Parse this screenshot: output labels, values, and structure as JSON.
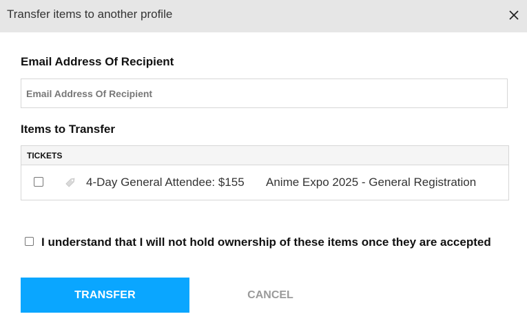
{
  "modal": {
    "title": "Transfer items to another profile",
    "close_icon": "close-icon"
  },
  "email": {
    "label": "Email Address Of Recipient",
    "value": "",
    "placeholder": "Email Address Of Recipient"
  },
  "items": {
    "label": "Items to Transfer",
    "section_header": "TICKETS",
    "tickets": [
      {
        "name": "4-Day General Attendee: $155",
        "event": "Anime Expo 2025 - General Registration",
        "checked": false,
        "icon": "ticket-tag-icon"
      }
    ]
  },
  "acknowledge": {
    "text": "I understand that I will not hold ownership of these items once they are accepted",
    "checked": false
  },
  "actions": {
    "transfer_label": "TRANSFER",
    "cancel_label": "CANCEL"
  },
  "colors": {
    "header_bg": "#e6e6e6",
    "primary": "#0aa6ff",
    "cancel_text": "#9a9a9a"
  }
}
